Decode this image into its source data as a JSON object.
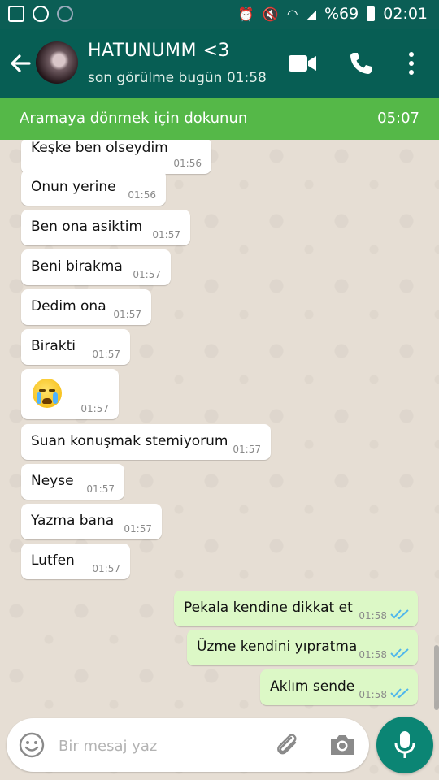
{
  "status_bar": {
    "battery": "%69",
    "time": "02:01",
    "left_icons": [
      "image-icon",
      "whatsapp-icon",
      "sync-icon"
    ],
    "right_icons": [
      "alarm-icon",
      "mute-icon",
      "wifi-icon",
      "signal-icon",
      "battery-icon"
    ]
  },
  "header": {
    "contact_name": "HATUNUMM <3",
    "last_seen": "son görülme bugün 01:58",
    "icons": [
      "back-arrow-icon",
      "video-call-icon",
      "phone-icon",
      "more-vert-icon"
    ]
  },
  "call_banner": {
    "text": "Aramaya dönmek için dokunun",
    "duration": "05:07"
  },
  "messages": [
    {
      "dir": "in",
      "text": "Keşke ben olseydim",
      "time": "01:56"
    },
    {
      "dir": "in",
      "text": "Onun yerine",
      "time": "01:56"
    },
    {
      "dir": "in",
      "text": "Ben ona asiktim",
      "time": "01:57"
    },
    {
      "dir": "in",
      "text": "Beni birakma",
      "time": "01:57"
    },
    {
      "dir": "in",
      "text": "Dedim ona",
      "time": "01:57"
    },
    {
      "dir": "in",
      "text": "Birakti",
      "time": "01:57"
    },
    {
      "dir": "in",
      "text": "",
      "emoji": "loudly-crying-face",
      "time": "01:57"
    },
    {
      "dir": "in",
      "text": "Suan konuşmak stemiyorum",
      "time": "01:57"
    },
    {
      "dir": "in",
      "text": "Neyse",
      "time": "01:57"
    },
    {
      "dir": "in",
      "text": "Yazma bana",
      "time": "01:57"
    },
    {
      "dir": "in",
      "text": "Lutfen",
      "time": "01:57"
    },
    {
      "dir": "out",
      "text": "Pekala kendine dikkat et",
      "time": "01:58",
      "status": "read"
    },
    {
      "dir": "out",
      "text": "Üzme kendini yıpratma",
      "time": "01:58",
      "status": "read"
    },
    {
      "dir": "out",
      "text": "Aklım sende",
      "time": "01:58",
      "status": "read"
    }
  ],
  "composer": {
    "placeholder": "Bir mesaj yaz",
    "icons": [
      "emoji-icon",
      "attach-icon",
      "camera-icon",
      "mic-icon"
    ]
  },
  "colors": {
    "header": "#075e54",
    "status_bar": "#0b5e55",
    "call_banner": "#55b848",
    "incoming_bubble": "#ffffff",
    "outgoing_bubble": "#dcf8c6",
    "read_ticks": "#4fb6ec",
    "mic_button": "#0b8574"
  }
}
